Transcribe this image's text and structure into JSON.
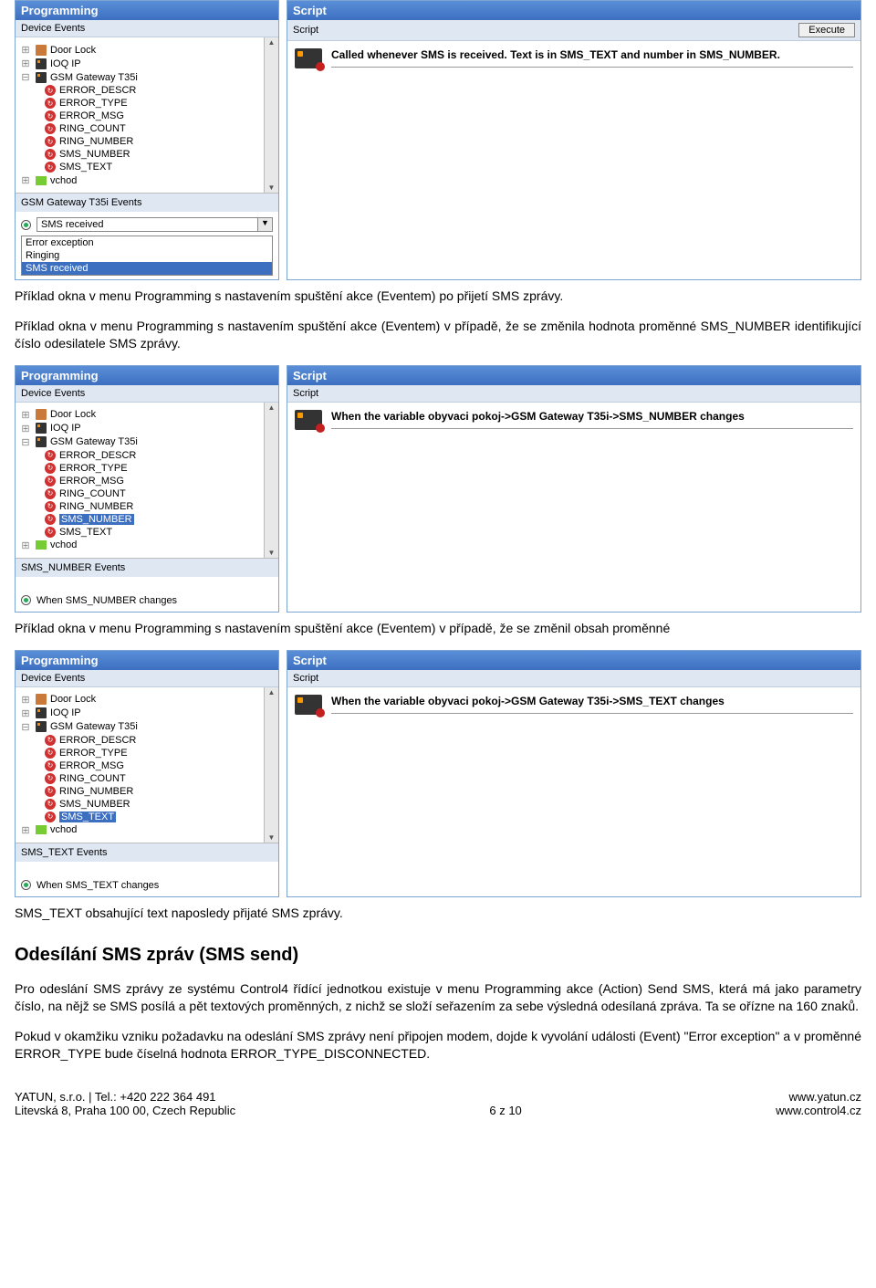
{
  "panels": {
    "programming_title": "Programming",
    "script_title": "Script",
    "device_events_label": "Device Events",
    "script_label": "Script",
    "execute_label": "Execute"
  },
  "tree": {
    "door_lock": "Door Lock",
    "ioq_ip": "IOQ IP",
    "gsm_gateway": "GSM Gateway T35i",
    "vars": {
      "error_descr": "ERROR_DESCR",
      "error_type": "ERROR_TYPE",
      "error_msg": "ERROR_MSG",
      "ring_count": "RING_COUNT",
      "ring_number": "RING_NUMBER",
      "sms_number": "SMS_NUMBER",
      "sms_text": "SMS_TEXT"
    },
    "vchod": "vchod"
  },
  "section1": {
    "events_bar": "GSM Gateway T35i Events",
    "dropdown_value": "SMS received",
    "list": {
      "error_exception": "Error exception",
      "ringing": "Ringing",
      "sms_received": "SMS received"
    },
    "script_text": "Called whenever SMS is received. Text is in SMS_TEXT and number in SMS_NUMBER."
  },
  "para1": "Příklad okna v menu Programming s nastavením spuštění akce (Eventem) po přijetí SMS zprávy.",
  "para2": "Příklad okna v menu Programming s nastavením spuštění akce (Eventem) v případě, že se změnila hodnota proměnné SMS_NUMBER identifikující číslo odesilatele SMS zprávy.",
  "section2": {
    "events_bar": "SMS_NUMBER Events",
    "radio_label": "When SMS_NUMBER changes",
    "script_text": "When the variable obyvaci pokoj->GSM Gateway T35i->SMS_NUMBER changes"
  },
  "para3": "Příklad okna v menu Programming s nastavením spuštění akce (Eventem) v případě, že se změnil obsah proměnné",
  "section3": {
    "events_bar": "SMS_TEXT Events",
    "radio_label": "When SMS_TEXT changes",
    "script_text": "When the variable obyvaci pokoj->GSM Gateway T35i->SMS_TEXT changes"
  },
  "para4": "SMS_TEXT obsahující text naposledy přijaté SMS zprávy.",
  "heading": "Odesílání SMS zpráv (SMS send)",
  "body1": "Pro odeslání SMS zprávy ze systému Control4 řídící jednotkou existuje v menu Programming akce (Action) Send SMS, která má jako parametry číslo, na nějž se SMS posílá a pět textových proměnných, z nichž se složí seřazením za sebe výsledná odesílaná zpráva. Ta se ořízne na 160 znaků.",
  "body2": "Pokud v okamžiku vzniku požadavku na odeslání SMS zprávy není připojen modem, dojde k vyvolání události (Event) \"Error exception\" a v proměnné ERROR_TYPE bude číselná hodnota ERROR_TYPE_DISCONNECTED.",
  "footer": {
    "left1": "YATUN, s.r.o. | Tel.: +420 222 364 491",
    "left2": "Litevská 8, Praha 100 00, Czech Republic",
    "center": "6 z 10",
    "right1": "www.yatun.cz",
    "right2": "www.control4.cz"
  }
}
